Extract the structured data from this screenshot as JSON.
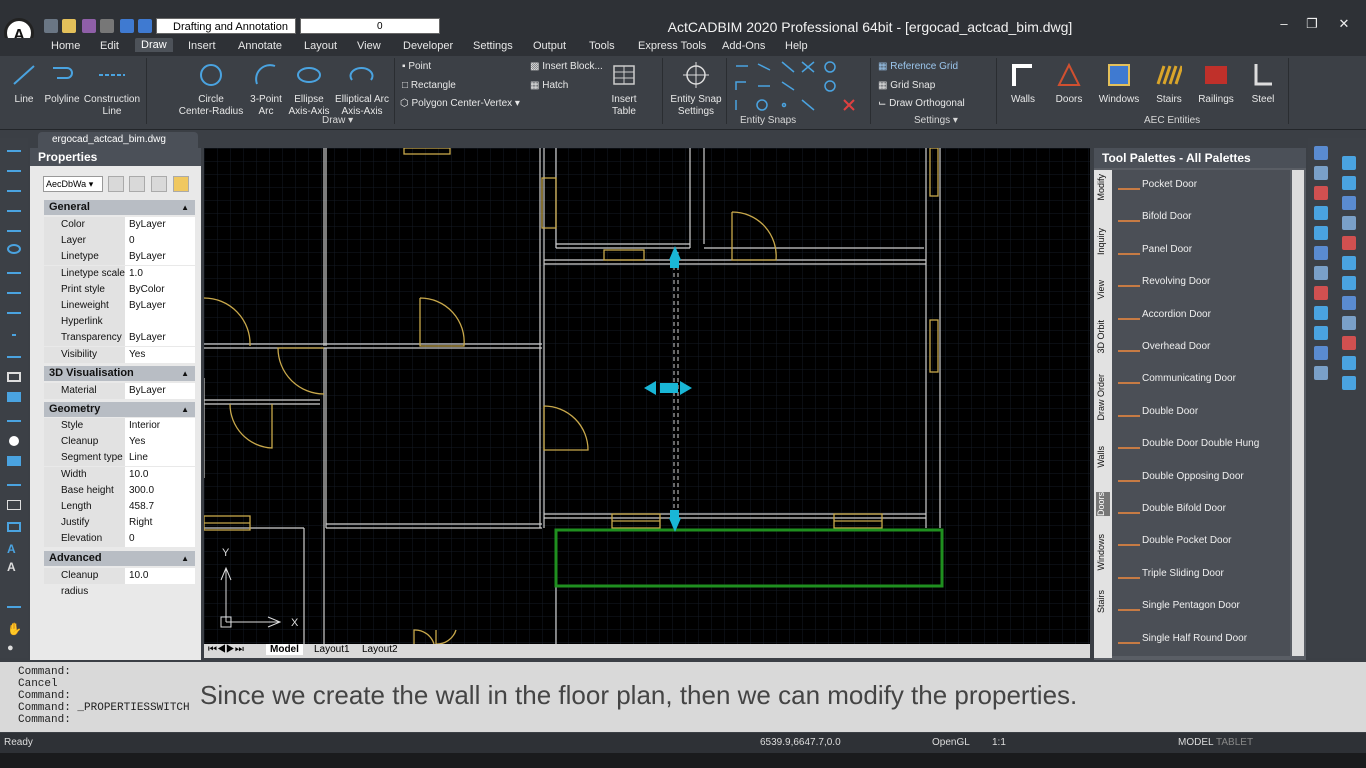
{
  "window": {
    "title": "ActCADBIM 2020 Professional 64bit - [ergocad_actcad_bim.dwg]",
    "workspace": "Drafting and Annotation",
    "layer": "0"
  },
  "menu": [
    "Home",
    "Edit",
    "Draw",
    "Insert",
    "Annotate",
    "Layout",
    "View",
    "Developer",
    "Settings",
    "Output",
    "Tools",
    "Express Tools",
    "Add-Ons",
    "Help"
  ],
  "ribbon": {
    "draw": {
      "line": "Line",
      "polyline": "Polyline",
      "construction1": "Construction",
      "construction2": "Line",
      "circle1": "Circle",
      "circle2": "Center-Radius",
      "arc1": "3-Point",
      "arc2": "Arc",
      "ellipse1": "Ellipse",
      "ellipse2": "Axis-Axis",
      "earc1": "Elliptical Arc",
      "earc2": "Axis-Axis",
      "point": "Point",
      "rectangle": "Rectangle",
      "polygon": "Polygon Center-Vertex",
      "insert_block": "Insert Block...",
      "hatch": "Hatch",
      "insert_table1": "Insert",
      "insert_table2": "Table",
      "snap1": "Entity Snap",
      "snap2": "Settings"
    },
    "settings": {
      "reference_grid": "Reference Grid",
      "grid_snap": "Grid Snap",
      "draw_orthogonal": "Draw Orthogonal"
    },
    "aec": [
      "Walls",
      "Doors",
      "Windows",
      "Stairs",
      "Railings",
      "Steel"
    ],
    "group_labels": {
      "draw": "Draw",
      "snaps": "Entity Snaps",
      "settings": "Settings",
      "aec": "AEC Entities"
    }
  },
  "document_tab": "ergocad_actcad_bim.dwg",
  "properties": {
    "title": "Properties",
    "selector": "AecDbWa",
    "sections": {
      "general": "General",
      "visualisation": "3D Visualisation",
      "geometry": "Geometry",
      "advanced": "Advanced"
    },
    "general": [
      [
        "Color",
        "ByLayer"
      ],
      [
        "Layer",
        "0"
      ],
      [
        "Linetype",
        "ByLayer"
      ],
      [
        "Linetype scale",
        "1.0"
      ],
      [
        "Print style",
        "ByColor"
      ],
      [
        "Lineweight",
        "ByLayer"
      ],
      [
        "Hyperlink",
        ""
      ],
      [
        "Transparency",
        "ByLayer"
      ],
      [
        "Visibility",
        "Yes"
      ]
    ],
    "visualisation": [
      [
        "Material",
        "ByLayer"
      ]
    ],
    "geometry": [
      [
        "Style",
        "Interior"
      ],
      [
        "Cleanup auto...",
        "Yes"
      ],
      [
        "Segment type",
        "Line"
      ],
      [
        "Width",
        "10.0"
      ],
      [
        "Base height",
        "300.0"
      ],
      [
        "Length",
        "458.7"
      ],
      [
        "Justify",
        "Right"
      ],
      [
        "Elevation",
        "0"
      ]
    ],
    "advanced": [
      [
        "Cleanup radius",
        "10.0"
      ]
    ]
  },
  "layout_tabs": [
    "Model",
    "Layout1",
    "Layout2"
  ],
  "ucs": {
    "x": "X",
    "y": "Y"
  },
  "tool_palette": {
    "title": "Tool Palettes - All Palettes",
    "vertical_tabs": [
      "Modify",
      "Inquiry",
      "View",
      "3D Orbit",
      "Draw Order",
      "Walls",
      "Doors",
      "Windows",
      "Stairs"
    ],
    "items": [
      "Pocket Door",
      "Bifold Door",
      "Panel Door",
      "Revolving Door",
      "Accordion Door",
      "Overhead Door",
      "Communicating Door",
      "Double Door",
      "Double Door Double Hung",
      "Double Opposing Door",
      "Double Bifold Door",
      "Double Pocket Door",
      "Triple Sliding Door",
      "Single Pentagon Door",
      "Single Half Round Door"
    ]
  },
  "command_lines": [
    "Command:",
    "Cancel",
    "Command:",
    "Command: _PROPERTIESSWITCH",
    "Command:"
  ],
  "subtitle": "Since we create the wall in the floor plan, then we can modify the properties.",
  "status": {
    "ready": "Ready",
    "coords": "6539.9,6647.7,0.0",
    "opengl": "OpenGL",
    "scale": "1:1",
    "model": "MODEL",
    "tablet": "TABLET"
  },
  "colors": {
    "accent": "#4aa3e0",
    "wall": "#c8a84b",
    "selection": "#19b6d6",
    "green": "#1f8f1f"
  }
}
